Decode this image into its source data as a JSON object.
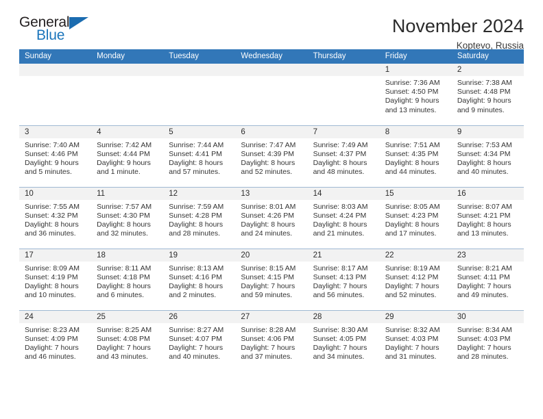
{
  "brand": {
    "word_one": "General",
    "word_two": "Blue",
    "triangle_icon": "triangle-icon",
    "accent_color": "#1b75bb"
  },
  "header": {
    "title": "November 2024",
    "location": "Koptevo, Russia"
  },
  "theme": {
    "header_blue": "#3277b8",
    "daynum_gray": "#f2f2f2",
    "row_border": "#9eb8d2"
  },
  "calendar": {
    "weekday_headers": [
      "Sunday",
      "Monday",
      "Tuesday",
      "Wednesday",
      "Thursday",
      "Friday",
      "Saturday"
    ],
    "labels": {
      "sunrise": "Sunrise:",
      "sunset": "Sunset:",
      "daylight": "Daylight:"
    },
    "weeks": [
      [
        {
          "day": "",
          "empty": true
        },
        {
          "day": "",
          "empty": true
        },
        {
          "day": "",
          "empty": true
        },
        {
          "day": "",
          "empty": true
        },
        {
          "day": "",
          "empty": true
        },
        {
          "day": "1",
          "sunrise": "Sunrise: 7:36 AM",
          "sunset": "Sunset: 4:50 PM",
          "daylight_1": "Daylight: 9 hours",
          "daylight_2": "and 13 minutes."
        },
        {
          "day": "2",
          "sunrise": "Sunrise: 7:38 AM",
          "sunset": "Sunset: 4:48 PM",
          "daylight_1": "Daylight: 9 hours",
          "daylight_2": "and 9 minutes."
        }
      ],
      [
        {
          "day": "3",
          "sunrise": "Sunrise: 7:40 AM",
          "sunset": "Sunset: 4:46 PM",
          "daylight_1": "Daylight: 9 hours",
          "daylight_2": "and 5 minutes."
        },
        {
          "day": "4",
          "sunrise": "Sunrise: 7:42 AM",
          "sunset": "Sunset: 4:44 PM",
          "daylight_1": "Daylight: 9 hours",
          "daylight_2": "and 1 minute."
        },
        {
          "day": "5",
          "sunrise": "Sunrise: 7:44 AM",
          "sunset": "Sunset: 4:41 PM",
          "daylight_1": "Daylight: 8 hours",
          "daylight_2": "and 57 minutes."
        },
        {
          "day": "6",
          "sunrise": "Sunrise: 7:47 AM",
          "sunset": "Sunset: 4:39 PM",
          "daylight_1": "Daylight: 8 hours",
          "daylight_2": "and 52 minutes."
        },
        {
          "day": "7",
          "sunrise": "Sunrise: 7:49 AM",
          "sunset": "Sunset: 4:37 PM",
          "daylight_1": "Daylight: 8 hours",
          "daylight_2": "and 48 minutes."
        },
        {
          "day": "8",
          "sunrise": "Sunrise: 7:51 AM",
          "sunset": "Sunset: 4:35 PM",
          "daylight_1": "Daylight: 8 hours",
          "daylight_2": "and 44 minutes."
        },
        {
          "day": "9",
          "sunrise": "Sunrise: 7:53 AM",
          "sunset": "Sunset: 4:34 PM",
          "daylight_1": "Daylight: 8 hours",
          "daylight_2": "and 40 minutes."
        }
      ],
      [
        {
          "day": "10",
          "sunrise": "Sunrise: 7:55 AM",
          "sunset": "Sunset: 4:32 PM",
          "daylight_1": "Daylight: 8 hours",
          "daylight_2": "and 36 minutes."
        },
        {
          "day": "11",
          "sunrise": "Sunrise: 7:57 AM",
          "sunset": "Sunset: 4:30 PM",
          "daylight_1": "Daylight: 8 hours",
          "daylight_2": "and 32 minutes."
        },
        {
          "day": "12",
          "sunrise": "Sunrise: 7:59 AM",
          "sunset": "Sunset: 4:28 PM",
          "daylight_1": "Daylight: 8 hours",
          "daylight_2": "and 28 minutes."
        },
        {
          "day": "13",
          "sunrise": "Sunrise: 8:01 AM",
          "sunset": "Sunset: 4:26 PM",
          "daylight_1": "Daylight: 8 hours",
          "daylight_2": "and 24 minutes."
        },
        {
          "day": "14",
          "sunrise": "Sunrise: 8:03 AM",
          "sunset": "Sunset: 4:24 PM",
          "daylight_1": "Daylight: 8 hours",
          "daylight_2": "and 21 minutes."
        },
        {
          "day": "15",
          "sunrise": "Sunrise: 8:05 AM",
          "sunset": "Sunset: 4:23 PM",
          "daylight_1": "Daylight: 8 hours",
          "daylight_2": "and 17 minutes."
        },
        {
          "day": "16",
          "sunrise": "Sunrise: 8:07 AM",
          "sunset": "Sunset: 4:21 PM",
          "daylight_1": "Daylight: 8 hours",
          "daylight_2": "and 13 minutes."
        }
      ],
      [
        {
          "day": "17",
          "sunrise": "Sunrise: 8:09 AM",
          "sunset": "Sunset: 4:19 PM",
          "daylight_1": "Daylight: 8 hours",
          "daylight_2": "and 10 minutes."
        },
        {
          "day": "18",
          "sunrise": "Sunrise: 8:11 AM",
          "sunset": "Sunset: 4:18 PM",
          "daylight_1": "Daylight: 8 hours",
          "daylight_2": "and 6 minutes."
        },
        {
          "day": "19",
          "sunrise": "Sunrise: 8:13 AM",
          "sunset": "Sunset: 4:16 PM",
          "daylight_1": "Daylight: 8 hours",
          "daylight_2": "and 2 minutes."
        },
        {
          "day": "20",
          "sunrise": "Sunrise: 8:15 AM",
          "sunset": "Sunset: 4:15 PM",
          "daylight_1": "Daylight: 7 hours",
          "daylight_2": "and 59 minutes."
        },
        {
          "day": "21",
          "sunrise": "Sunrise: 8:17 AM",
          "sunset": "Sunset: 4:13 PM",
          "daylight_1": "Daylight: 7 hours",
          "daylight_2": "and 56 minutes."
        },
        {
          "day": "22",
          "sunrise": "Sunrise: 8:19 AM",
          "sunset": "Sunset: 4:12 PM",
          "daylight_1": "Daylight: 7 hours",
          "daylight_2": "and 52 minutes."
        },
        {
          "day": "23",
          "sunrise": "Sunrise: 8:21 AM",
          "sunset": "Sunset: 4:11 PM",
          "daylight_1": "Daylight: 7 hours",
          "daylight_2": "and 49 minutes."
        }
      ],
      [
        {
          "day": "24",
          "sunrise": "Sunrise: 8:23 AM",
          "sunset": "Sunset: 4:09 PM",
          "daylight_1": "Daylight: 7 hours",
          "daylight_2": "and 46 minutes."
        },
        {
          "day": "25",
          "sunrise": "Sunrise: 8:25 AM",
          "sunset": "Sunset: 4:08 PM",
          "daylight_1": "Daylight: 7 hours",
          "daylight_2": "and 43 minutes."
        },
        {
          "day": "26",
          "sunrise": "Sunrise: 8:27 AM",
          "sunset": "Sunset: 4:07 PM",
          "daylight_1": "Daylight: 7 hours",
          "daylight_2": "and 40 minutes."
        },
        {
          "day": "27",
          "sunrise": "Sunrise: 8:28 AM",
          "sunset": "Sunset: 4:06 PM",
          "daylight_1": "Daylight: 7 hours",
          "daylight_2": "and 37 minutes."
        },
        {
          "day": "28",
          "sunrise": "Sunrise: 8:30 AM",
          "sunset": "Sunset: 4:05 PM",
          "daylight_1": "Daylight: 7 hours",
          "daylight_2": "and 34 minutes."
        },
        {
          "day": "29",
          "sunrise": "Sunrise: 8:32 AM",
          "sunset": "Sunset: 4:03 PM",
          "daylight_1": "Daylight: 7 hours",
          "daylight_2": "and 31 minutes."
        },
        {
          "day": "30",
          "sunrise": "Sunrise: 8:34 AM",
          "sunset": "Sunset: 4:03 PM",
          "daylight_1": "Daylight: 7 hours",
          "daylight_2": "and 28 minutes."
        }
      ]
    ]
  }
}
